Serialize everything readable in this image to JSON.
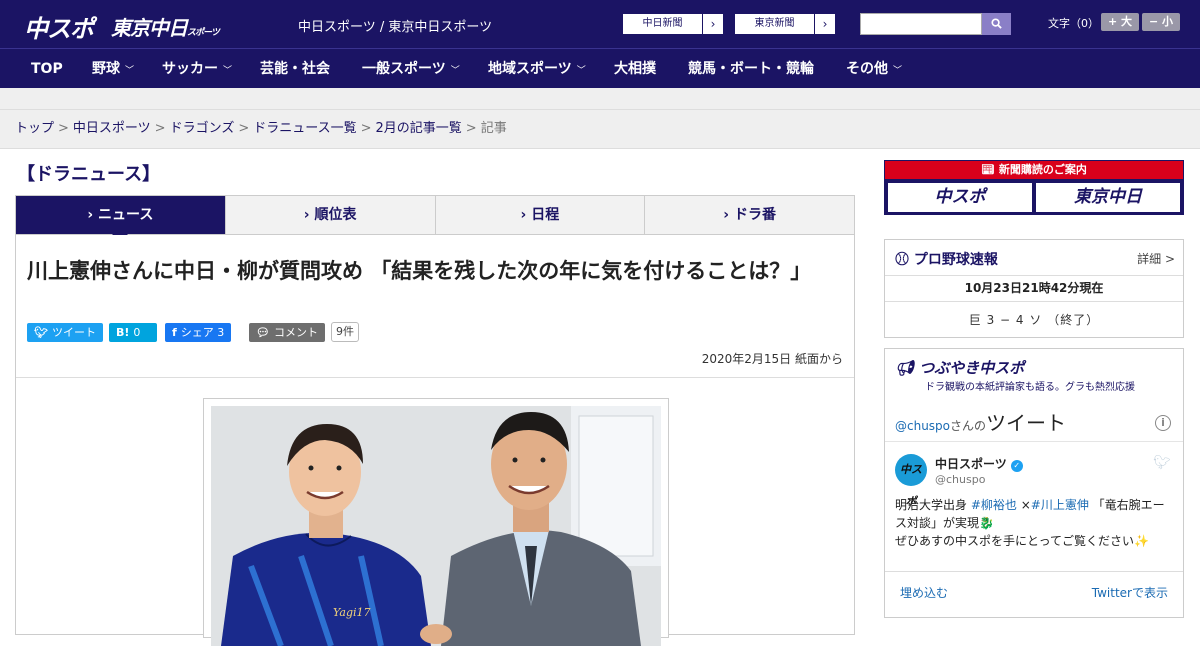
{
  "header": {
    "logo_primary": "中スポ",
    "logo_secondary": "東京中日",
    "logo_secondary_small": "スポーツ",
    "site_title": "中日スポーツ / 東京中日スポーツ",
    "paper_links": [
      {
        "label": "中日新聞"
      },
      {
        "label": "東京新聞"
      }
    ],
    "search": {
      "placeholder": ""
    },
    "font_size_label": "文字（0）",
    "font_up": "+ 大",
    "font_down": "− 小"
  },
  "nav": {
    "items": [
      {
        "label": "TOP",
        "chevron": ""
      },
      {
        "label": "野球",
        "chevron": "﹀"
      },
      {
        "label": "サッカー",
        "chevron": "﹀"
      },
      {
        "label": "芸能・社会",
        "chevron": ""
      },
      {
        "label": "一般スポーツ",
        "chevron": "﹀"
      },
      {
        "label": "地域スポーツ",
        "chevron": "﹀"
      },
      {
        "label": "大相撲",
        "chevron": ""
      },
      {
        "label": "競馬・ボート・競輪",
        "chevron": ""
      },
      {
        "label": "その他",
        "chevron": "﹀"
      }
    ]
  },
  "breadcrumb": {
    "items": [
      "トップ",
      "中日スポーツ",
      "ドラゴンズ",
      "ドラニュース一覧",
      "2月の記事一覧"
    ],
    "current": "記事",
    "separator": ">"
  },
  "section_title": "【ドラニュース】",
  "tabs": [
    {
      "label": "ニュース",
      "active": true
    },
    {
      "label": "順位表",
      "active": false
    },
    {
      "label": "日程",
      "active": false
    },
    {
      "label": "ドラ番",
      "active": false
    }
  ],
  "article": {
    "headline": "川上憲伸さんに中日・柳が質問攻め 「結果を残した次の年に気を付けることは？」",
    "share": {
      "tweet": "ツイート",
      "hatena_icon": "B!",
      "hatena_count": "0",
      "facebook": "シェア",
      "facebook_count": "3",
      "comment": "コメント",
      "comment_count": "9件"
    },
    "date": "2020年2月15日 紙面から",
    "photo_jersey_text": "Yagi17"
  },
  "sidebar": {
    "promo": {
      "heading": "新聞購読のご案内",
      "left": "中スポ",
      "right": "東京中日"
    },
    "scores": {
      "title": "プロ野球速報",
      "more": "詳細 >",
      "updated": "10月23日21時42分現在",
      "game": "巨 3 − 4 ソ （終了）"
    },
    "twitter": {
      "title": "つぶやき中スポ",
      "subtitle": "ドラ観戦の本紙評論家も語る。グラも熱烈応援",
      "handle": "@chuspo",
      "handle_suffix": "さんの",
      "handle_big": "ツイート",
      "info": "i",
      "account_name": "中日スポーツ",
      "account_id": "@chuspo",
      "avatar_text": "中スポ",
      "tweet_line1_a": "明治大学出身 ",
      "tweet_tag1": "#柳裕也",
      "tweet_line1_b": " ×",
      "tweet_tag2": "#川上憲伸",
      "tweet_line1_c": " 「竜右腕エース対談」が実現",
      "tweet_line2": "ぜひあすの中スポを手にとってご覧ください",
      "embed": "埋め込む",
      "view_on_twitter": "Twitterで表示"
    }
  },
  "colors": {
    "brand_navy": "#1b1464",
    "promo_red": "#d9001b",
    "twitter_blue": "#1da1f2",
    "facebook_blue": "#1877f2",
    "hatena_blue": "#00a4de"
  }
}
